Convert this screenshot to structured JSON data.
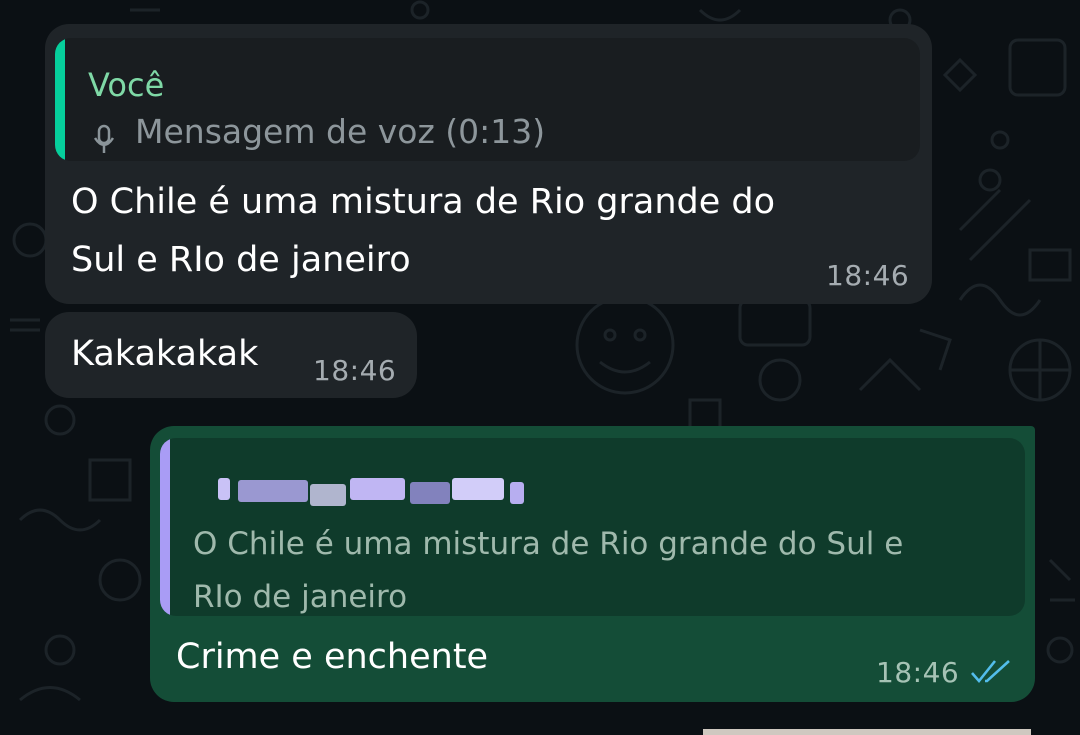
{
  "messages": [
    {
      "direction": "incoming",
      "quote": {
        "author": "Você",
        "author_color": "#53bdeb",
        "content": "Mensagem de voz (0:13)",
        "content_icon": "mic-icon",
        "bar_color": "#06cf9c"
      },
      "text": "O Chile é uma mistura de Rio grande do\nSul e RIo de janeiro",
      "time": "18:46"
    },
    {
      "direction": "incoming",
      "text": "Kakakakak",
      "time": "18:46"
    },
    {
      "direction": "outgoing",
      "quote": {
        "author_redacted": true,
        "content": "O Chile é uma mistura de Rio grande do Sul e\nRIo de janeiro",
        "bar_color": "#a99cf5"
      },
      "text": "Crime e enchente",
      "time": "18:46",
      "status_icon": "double-check-read-icon",
      "status_color": "#53bdeb"
    }
  ],
  "colors": {
    "wallpaper": "#0b1014",
    "incoming_bubble": "#1f2428",
    "outgoing_bubble": "#144d37",
    "voce_author": "#7fd9a6"
  }
}
